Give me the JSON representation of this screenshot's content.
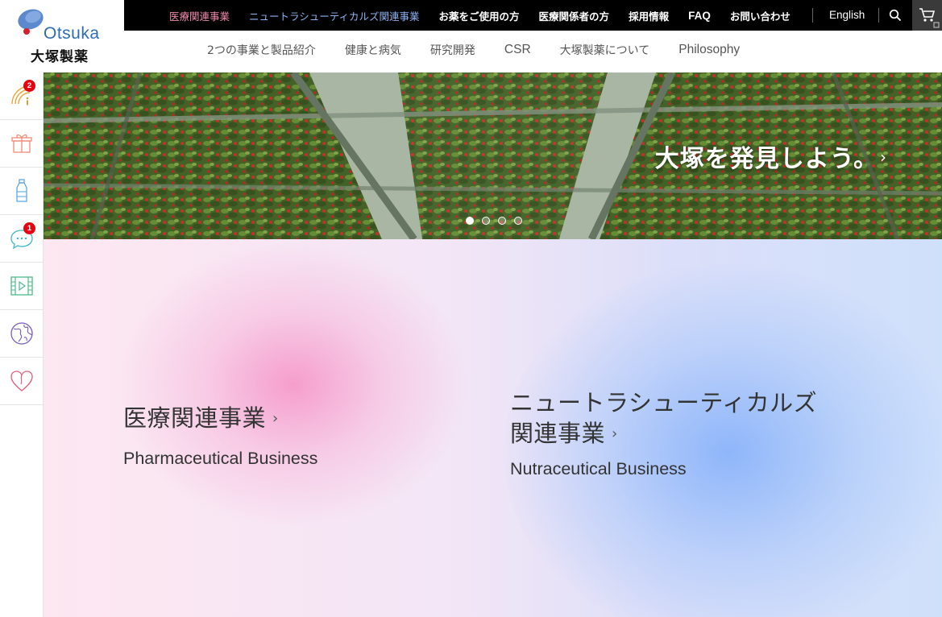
{
  "logo": {
    "en": "Otsuka",
    "jp": "大塚製薬"
  },
  "topnav": {
    "items": [
      {
        "label": "医療関連事業"
      },
      {
        "label": "ニュートラシューティカルズ関連事業"
      },
      {
        "label": "お薬をご使用の方"
      },
      {
        "label": "医療関係者の方"
      },
      {
        "label": "採用情報"
      },
      {
        "label": "FAQ"
      },
      {
        "label": "お問い合わせ"
      }
    ],
    "english": "English",
    "search_icon": "search-icon",
    "cart_icon": "cart-icon"
  },
  "subnav": {
    "items": [
      {
        "label": "2つの事業と製品紹介"
      },
      {
        "label": "健康と病気"
      },
      {
        "label": "研究開発"
      },
      {
        "label": "CSR"
      },
      {
        "label": "大塚製薬について"
      },
      {
        "label": "Philosophy"
      }
    ]
  },
  "sidebar": {
    "items": [
      {
        "icon": "info-broadcast-icon",
        "badge": "2"
      },
      {
        "icon": "gift-icon",
        "badge": ""
      },
      {
        "icon": "bottle-icon",
        "badge": ""
      },
      {
        "icon": "chat-bubble-icon",
        "badge": "1"
      },
      {
        "icon": "video-film-icon",
        "badge": ""
      },
      {
        "icon": "globe-icon",
        "badge": ""
      },
      {
        "icon": "heart-icon",
        "badge": ""
      }
    ]
  },
  "hero": {
    "title": "大塚を発見しよう。",
    "chevron": "›",
    "slides": 4,
    "active_slide": 1
  },
  "business": {
    "pharma": {
      "jp": "医療関連事業",
      "en": "Pharmaceutical Business"
    },
    "nutra": {
      "jp_line1": "ニュートラシューティカルズ",
      "jp_line2": "関連事業",
      "en": "Nutraceutical Business"
    },
    "chevron": "›"
  },
  "colors": {
    "topbar": "#000000",
    "pink_link": "#f08cae",
    "blue_link": "#8fb4f5",
    "logo_blue": "#2d6db5",
    "badge_red": "#e60012"
  }
}
